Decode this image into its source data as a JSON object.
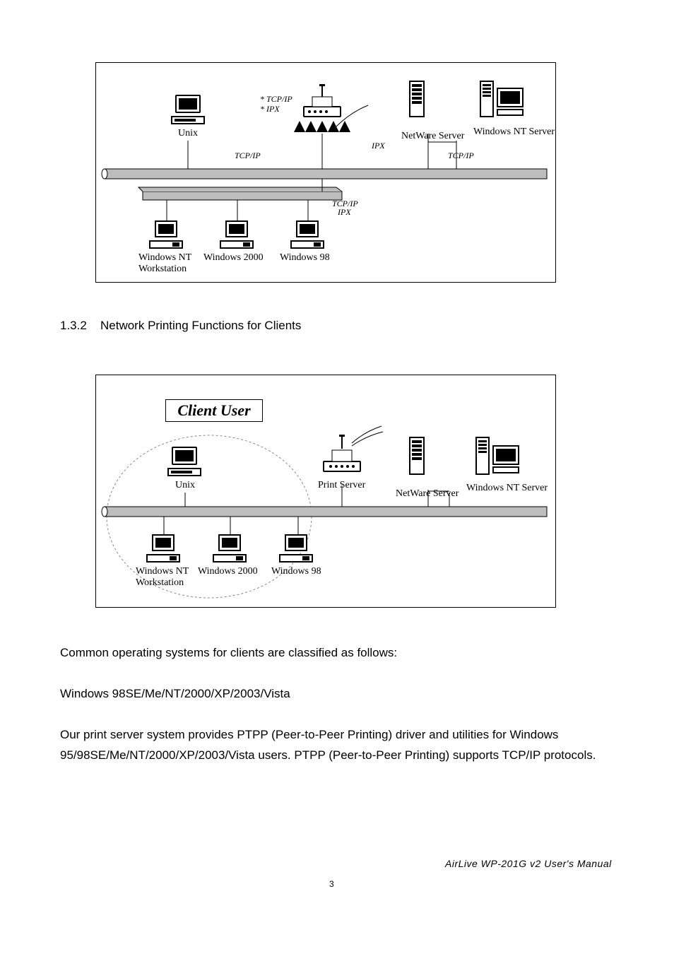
{
  "diagram1": {
    "unix": "Unix",
    "proto_box": {
      "l1": "* TCP/IP",
      "l2": "* IPX"
    },
    "tcpip": "TCP/IP",
    "ipx": "IPX",
    "tcpip2": "TCP/IP",
    "netware": "NetWare Server",
    "ntserver": "Windows NT Server",
    "ws_nt_l1": "Windows NT",
    "ws_nt_l2": "Workstation",
    "ws_2000": "Windows 2000",
    "ws_98": "Windows 98",
    "overlay": {
      "l1": "TCP/IP",
      "l2": "IPX"
    }
  },
  "section": {
    "num": "1.3.2",
    "title": "Network Printing Functions for Clients"
  },
  "diagram2": {
    "client_user": "Client User",
    "unix": "Unix",
    "print_server": "Print Server",
    "netware": "NetWare Server",
    "ntserver": "Windows NT Server",
    "ws_nt_l1": "Windows NT",
    "ws_nt_l2": "Workstation",
    "ws_2000": "Windows 2000",
    "ws_98": "Windows 98"
  },
  "para1": "Common operating systems for clients are classified as follows:",
  "para2": "Windows 98SE/Me/NT/2000/XP/2003/Vista",
  "para3": "Our print server system provides PTPP (Peer-to-Peer Printing) driver and utilities for Windows 95/98SE/Me/NT/2000/XP/2003/Vista users. PTPP (Peer-to-Peer Printing) supports TCP/IP protocols.",
  "footer": "AirLive  WP-201G  v2  User's  Manual",
  "page_number": "3"
}
